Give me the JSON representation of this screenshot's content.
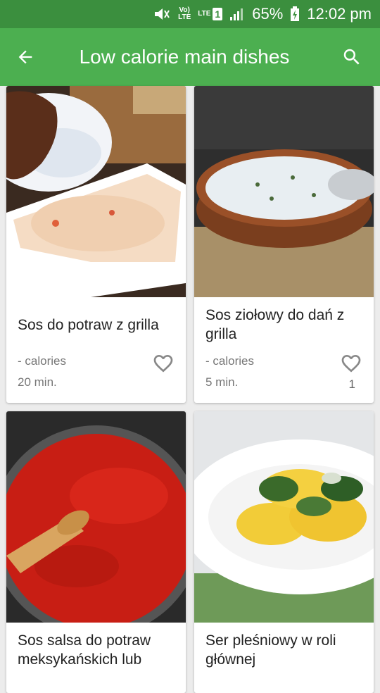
{
  "status_bar": {
    "volte": "Vo)",
    "lte_small": "LTE",
    "lte": "LTE",
    "sim": "1",
    "battery": "65%",
    "time": "12:02 pm"
  },
  "header": {
    "title": "Low calorie main dishes"
  },
  "colors": {
    "status_bar": "#3b8f3e",
    "app_bar": "#4caf50"
  },
  "cards": [
    {
      "title": "Sos do potraw z grilla",
      "calories": "- calories",
      "time": "20 min.",
      "likes": ""
    },
    {
      "title": "Sos ziołowy do dań z grilla",
      "calories": "- calories",
      "time": "5 min.",
      "likes": "1"
    },
    {
      "title": "Sos salsa do potraw meksykańskich lub",
      "calories": "",
      "time": "",
      "likes": ""
    },
    {
      "title": "Ser pleśniowy w roli głównej",
      "calories": "",
      "time": "",
      "likes": ""
    }
  ]
}
